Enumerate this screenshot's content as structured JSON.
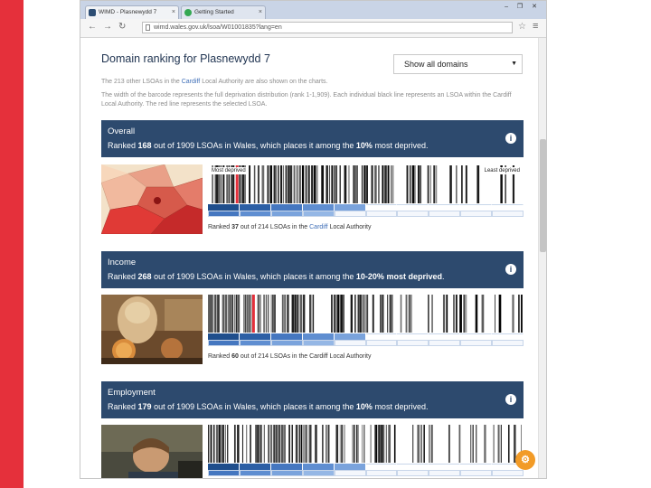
{
  "browser": {
    "tabs": [
      {
        "label": "WIMD - Plasnewydd 7"
      },
      {
        "label": "Getting Started"
      }
    ],
    "address": "wimd.wales.gov.uk/lsoa/W01001835?lang=en"
  },
  "page": {
    "title": "Domain ranking for Plasnewydd 7",
    "select": {
      "value": "Show all domains"
    },
    "intro1_prefix": "The 213 other LSOAs in the",
    "intro1_link": "Cardiff",
    "intro1_suffix": "Local Authority are also shown on the charts.",
    "intro2": "The width of the barcode represents the full deprivation distribution (rank 1-1,909). Each individual black line represents an LSOA within the Cardiff Local Authority. The red line represents the selected LSOA.",
    "most_label": "Most deprived",
    "least_label": "Least deprived"
  },
  "domains": [
    {
      "title": "Overall",
      "ranked_prefix": "Ranked",
      "rank": "168",
      "out_of": "out of 1909 LSOAs in Wales, which places it among the",
      "band": "10%",
      "most_deprived": "most deprived",
      "local_prefix": "Ranked",
      "local_rank": "37",
      "local_out_of": "out of 214 LSOAs in the",
      "local_link": "Cardiff",
      "local_suffix": "Local Authority",
      "photo": "map",
      "red_pos": 0.088
    },
    {
      "title": "Income",
      "ranked_prefix": "Ranked",
      "rank": "268",
      "out_of": "out of 1909 LSOAs in Wales, which places it among the",
      "band": "10-20%",
      "most_deprived": "most deprived",
      "local_prefix": "Ranked",
      "local_rank": "60",
      "local_out_of": "out of 214 LSOAs in the Cardiff Local Authority",
      "local_link": "",
      "local_suffix": "",
      "photo": "banknote",
      "red_pos": 0.14
    },
    {
      "title": "Employment",
      "ranked_prefix": "Ranked",
      "rank": "179",
      "out_of": "out of 1909 LSOAs in Wales, which places it among the",
      "band": "10%",
      "most_deprived": "most deprived",
      "photo": "worker",
      "red_pos": -1
    }
  ],
  "colors": {
    "header": "#2d4a6e",
    "red": "#e5303b",
    "deciles": [
      "#1f4e8c",
      "#2c5fa5",
      "#4577c0",
      "#5f8ed1",
      "#7aa3dc",
      "#95b7e5",
      "#afcaed",
      "#c8dbf4",
      "#dde8f8",
      "#eef3fb"
    ],
    "badge": "#f29b27"
  },
  "icons": {
    "info": "info-icon",
    "badge": "gear-badge-icon"
  }
}
